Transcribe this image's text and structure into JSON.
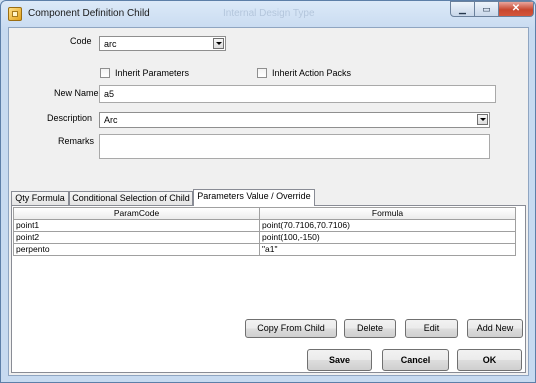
{
  "window": {
    "title": "Component Definition Child",
    "ghost_title": "Internal Design Type"
  },
  "form": {
    "code_label": "Code",
    "code_value": "arc",
    "inherit_parameters_label": "Inherit Parameters",
    "inherit_action_packs_label": "Inherit Action Packs",
    "new_name_label": "New Name",
    "new_name_value": "a5",
    "description_label": "Description",
    "description_value": "Arc",
    "remarks_label": "Remarks",
    "remarks_value": ""
  },
  "tabs": [
    {
      "label": "Qty Formula"
    },
    {
      "label": "Conditional Selection of Child"
    },
    {
      "label": "Parameters Value / Override"
    }
  ],
  "grid": {
    "headers": [
      "ParamCode",
      "Formula"
    ],
    "rows": [
      {
        "code": "point1",
        "formula": "point(70.7106,70.7106)"
      },
      {
        "code": "point2",
        "formula": "point(100,-150)"
      },
      {
        "code": "perpento",
        "formula": "\"a1\""
      }
    ]
  },
  "grid_buttons": {
    "copy": "Copy From Child",
    "delete": "Delete",
    "edit": "Edit",
    "add": "Add New"
  },
  "dialog_buttons": {
    "save": "Save",
    "cancel": "Cancel",
    "ok": "OK"
  }
}
